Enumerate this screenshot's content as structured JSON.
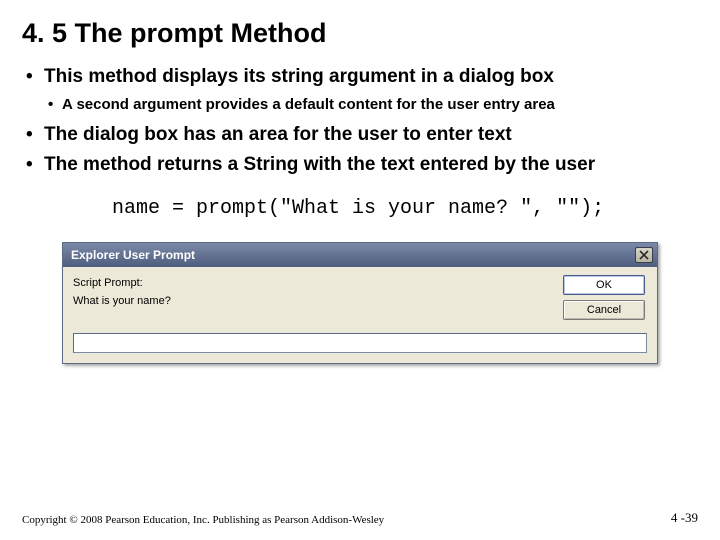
{
  "slide": {
    "title": "4. 5 The prompt Method",
    "bullets": [
      {
        "level": 1,
        "text": "This method displays its string argument in a dialog box"
      },
      {
        "level": 2,
        "text": "A second argument provides a default content for the user entry area"
      },
      {
        "level": 1,
        "text": "The dialog box has an area for the user to enter text"
      },
      {
        "level": 1,
        "text": "The method returns a String with the text entered by the user"
      }
    ],
    "code": "name = prompt(\"What is your name? \", \"\");",
    "footer": "Copyright © 2008 Pearson Education, Inc. Publishing as Pearson Addison-Wesley",
    "page_number": "4 -39"
  },
  "dialog": {
    "title": "Explorer User Prompt",
    "script_prompt_label": "Script Prompt:",
    "message": "What is your name?",
    "input_value": "",
    "ok_label": "OK",
    "cancel_label": "Cancel"
  }
}
